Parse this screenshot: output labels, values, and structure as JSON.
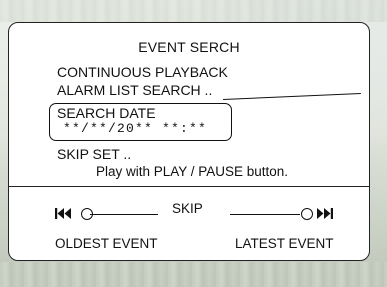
{
  "menu": {
    "title": "EVENT SERCH",
    "items": [
      {
        "label": "CONTINUOUS PLAYBACK"
      },
      {
        "label": "ALARM LIST SEARCH .."
      },
      {
        "label": "SEARCH DATE",
        "value": "**/**/20** **:**"
      },
      {
        "label": "SKIP SET .."
      }
    ],
    "hint": "Play with PLAY / PAUSE button."
  },
  "skip": {
    "label": "SKIP",
    "oldest_label": "OLDEST EVENT",
    "latest_label": "LATEST EVENT",
    "back_icon": "skip-back-icon",
    "forward_icon": "skip-forward-icon"
  },
  "colors": {
    "text": "#111111",
    "panel": "#ffffff",
    "border": "#222222"
  }
}
